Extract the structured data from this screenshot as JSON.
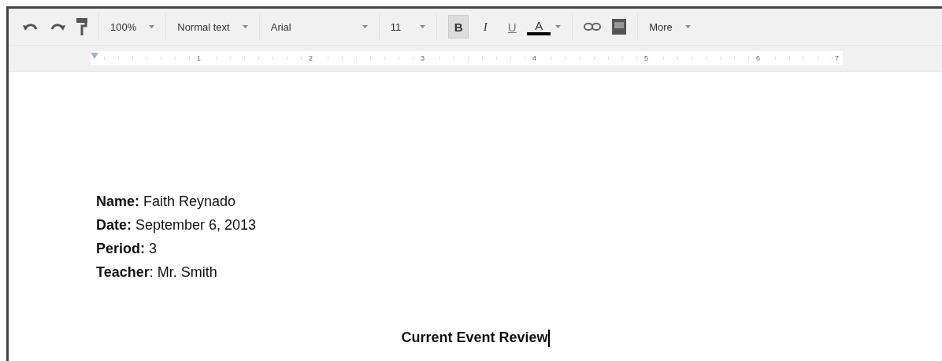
{
  "toolbar": {
    "zoom": "100%",
    "style": "Normal text",
    "font": "Arial",
    "size": "11",
    "format_buttons": [
      {
        "kind": "bold",
        "label": "B",
        "selected": true
      },
      {
        "kind": "italic",
        "label": "I",
        "selected": false
      },
      {
        "kind": "underline",
        "label": "U",
        "selected": false
      },
      {
        "kind": "color",
        "label": "A",
        "selected": false,
        "color": "#000000"
      }
    ],
    "more": "More"
  },
  "ruler": {
    "numbers": [
      "1",
      "2",
      "3",
      "4",
      "5",
      "6",
      "7"
    ]
  },
  "document": {
    "lines": [
      "**Name:** Faith Reynado",
      "**Date:** September 6, 2013",
      "**Period:** 3",
      "**Teacher**: Mr. Smith"
    ],
    "title": "Current Event Review"
  }
}
